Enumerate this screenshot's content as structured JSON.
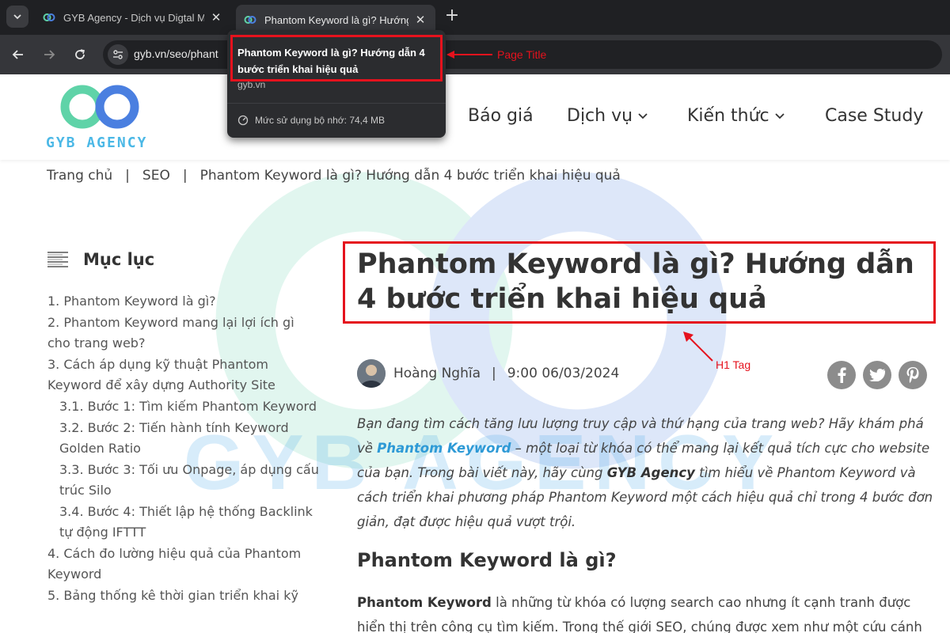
{
  "browser": {
    "tabs": [
      {
        "title": "GYB Agency - Dịch vụ Digtal M",
        "active": false
      },
      {
        "title": "Phantom Keyword là gì? Hướng",
        "active": true
      }
    ],
    "new_tab": "+",
    "url": "gyb.vn/seo/phant",
    "tooltip": {
      "title": "Phantom Keyword là gì? Hướng dẫn 4 bước triển khai hiệu quả",
      "domain": "gyb.vn",
      "memory": "Mức sử dụng bộ nhớ: 74,4 MB"
    }
  },
  "annotations": {
    "page_title": "Page Title",
    "h1_tag": "H1 Tag",
    "color": "#e5121d"
  },
  "site": {
    "logo_text": "GYB AGENCY",
    "menu": [
      {
        "label": "Báo giá",
        "dropdown": false
      },
      {
        "label": "Dịch vụ",
        "dropdown": true
      },
      {
        "label": "Kiến thức",
        "dropdown": true
      },
      {
        "label": "Case Study",
        "dropdown": false
      }
    ],
    "watermark_text": "GYB AGENCY",
    "breadcrumb": [
      "Trang chủ",
      "SEO",
      "Phantom Keyword là gì? Hướng dẫn 4 bước triển khai hiệu quả"
    ]
  },
  "toc": {
    "title": "Mục lục",
    "items": [
      {
        "text": "1. Phantom Keyword là gì?",
        "sub": false
      },
      {
        "text": "2. Phantom Keyword mang lại lợi ích gì cho trang web?",
        "sub": false
      },
      {
        "text": "3. Cách áp dụng kỹ thuật Phantom Keyword để xây dựng Authority Site",
        "sub": false
      },
      {
        "text": "3.1. Bước 1: Tìm kiếm Phantom Keyword",
        "sub": true
      },
      {
        "text": "3.2. Bước 2: Tiến hành tính Keyword Golden Ratio",
        "sub": true
      },
      {
        "text": "3.3. Bước 3: Tối ưu Onpage, áp dụng cấu trúc Silo",
        "sub": true
      },
      {
        "text": "3.4. Bước 4: Thiết lập hệ thống Backlink tự động IFTTT",
        "sub": true
      },
      {
        "text": "4. Cách đo lường hiệu quả của Phantom Keyword",
        "sub": false
      },
      {
        "text": "5. Bảng thống kê thời gian triển khai kỹ",
        "sub": false
      }
    ]
  },
  "article": {
    "h1": "Phantom Keyword là gì? Hướng dẫn 4 bước triển khai hiệu quả",
    "author": "Hoàng Nghĩa",
    "datetime": "9:00 06/03/2024",
    "social": [
      "facebook-icon",
      "twitter-icon",
      "pinterest-icon"
    ],
    "intro": {
      "p1": "Bạn đang tìm cách tăng lưu lượng truy cập và thứ hạng của trang web? Hãy khám phá về ",
      "link": "Phantom Keyword",
      "p2": " – một loại từ khóa có thể mang lại kết quả tích cực cho website của bạn. Trong bài viết này, hãy cùng ",
      "brand": "GYB Agency",
      "p3": " tìm hiểu về Phantom Keyword và cách triển khai phương pháp Phantom Keyword một cách hiệu quả chỉ trong 4 bước đơn giản, đạt được hiệu quả vượt trội."
    },
    "h2": "Phantom Keyword là gì?",
    "para": {
      "bold": "Phantom Keyword",
      "rest": " là những từ khóa có lượng search cao nhưng ít cạnh tranh được hiển thị trên công cụ tìm kiếm. Trong thế giới SEO, chúng được xem như một cứu cánh cho"
    }
  }
}
